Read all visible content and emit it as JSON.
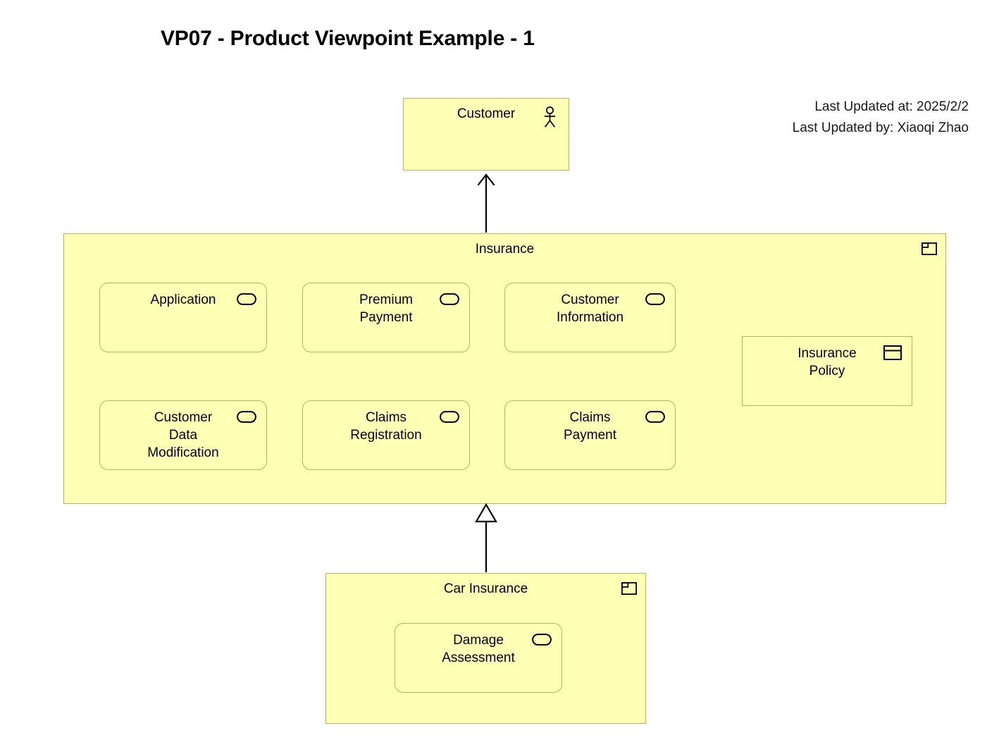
{
  "title": "VP07 - Product Viewpoint Example - 1",
  "meta": {
    "last_updated_at": "Last Updated at: 2025/2/2",
    "last_updated_by": "Last Updated by: Xiaoqi Zhao"
  },
  "colors": {
    "element_fill": "#FFFFB5",
    "element_border": "#B3B36B",
    "text": "#000000",
    "connector": "#000000",
    "background": "#FFFFFF"
  },
  "elements": {
    "customer": {
      "label": "Customer",
      "type": "business-actor",
      "icon": "actor-icon"
    },
    "insurance": {
      "label": "Insurance",
      "type": "product",
      "icon": "product-icon"
    },
    "car_insurance": {
      "label": "Car Insurance",
      "type": "product",
      "icon": "product-icon"
    },
    "insurance_policy": {
      "label_line1": "Insurance",
      "label_line2": "Policy",
      "type": "contract",
      "icon": "contract-icon"
    }
  },
  "insurance_services": [
    {
      "label_line1": "Application",
      "label_line2": "",
      "label_line3": "",
      "icon": "service-icon"
    },
    {
      "label_line1": "Premium",
      "label_line2": "Payment",
      "label_line3": "",
      "icon": "service-icon"
    },
    {
      "label_line1": "Customer",
      "label_line2": "Information",
      "label_line3": "",
      "icon": "service-icon"
    },
    {
      "label_line1": "Customer",
      "label_line2": "Data",
      "label_line3": "Modification",
      "icon": "service-icon"
    },
    {
      "label_line1": "Claims",
      "label_line2": "Registration",
      "label_line3": "",
      "icon": "service-icon"
    },
    {
      "label_line1": "Claims",
      "label_line2": "Payment",
      "label_line3": "",
      "icon": "service-icon"
    }
  ],
  "car_insurance_services": [
    {
      "label_line1": "Damage",
      "label_line2": "Assessment",
      "label_line3": "",
      "icon": "service-icon"
    }
  ],
  "relationships": [
    {
      "name": "serving",
      "source": "Insurance",
      "target": "Customer",
      "arrowhead": "open-arrow"
    },
    {
      "name": "specialization",
      "source": "Car Insurance",
      "target": "Insurance",
      "arrowhead": "hollow-triangle"
    }
  ]
}
